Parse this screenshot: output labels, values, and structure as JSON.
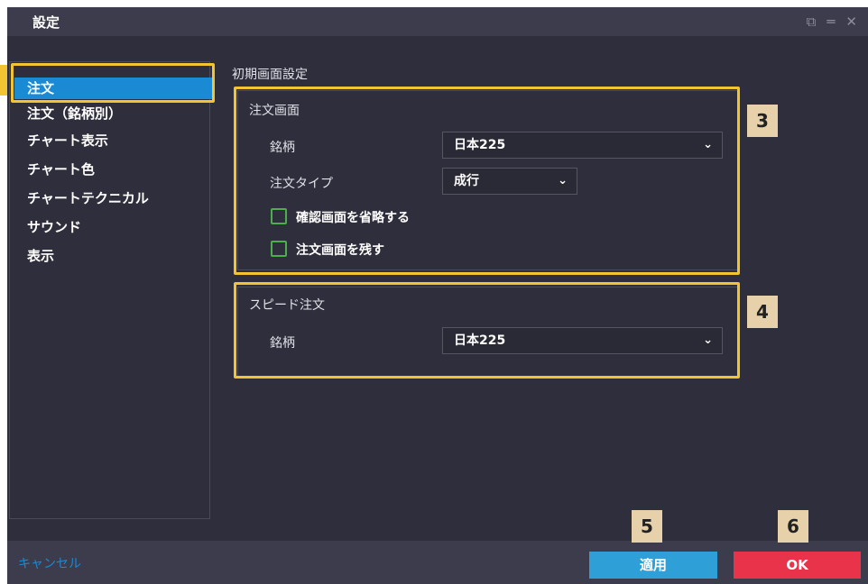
{
  "window": {
    "title": "設定",
    "icons": [
      "restore-icon",
      "minimize-icon",
      "close-icon"
    ]
  },
  "sidebar": {
    "items": [
      {
        "label": "注文",
        "active": true
      },
      {
        "label": "注文（銘柄別）"
      },
      {
        "label": "チャート表示"
      },
      {
        "label": "チャート色"
      },
      {
        "label": "チャートテクニカル"
      },
      {
        "label": "サウンド"
      },
      {
        "label": "表示"
      }
    ]
  },
  "main": {
    "heading": "初期画面設定",
    "order_screen": {
      "title": "注文画面",
      "symbol_label": "銘柄",
      "symbol_value": "日本225",
      "order_type_label": "注文タイプ",
      "order_type_value": "成行",
      "skip_confirm_label": "確認画面を省略する",
      "skip_confirm_checked": false,
      "keep_screen_label": "注文画面を残す",
      "keep_screen_checked": false
    },
    "speed_order": {
      "title": "スピード注文",
      "symbol_label": "銘柄",
      "symbol_value": "日本225"
    }
  },
  "annotations": {
    "badge_3": "3",
    "badge_4": "4",
    "badge_5": "5",
    "badge_6": "6"
  },
  "footer": {
    "cancel_label": "キャンセル",
    "apply_label": "適用",
    "ok_label": "OK"
  },
  "colors": {
    "accent": "#1a8ad4",
    "highlight": "#f3c431",
    "apply": "#2f9fd8",
    "ok": "#e8334a",
    "badge": "#e6d1ab"
  }
}
